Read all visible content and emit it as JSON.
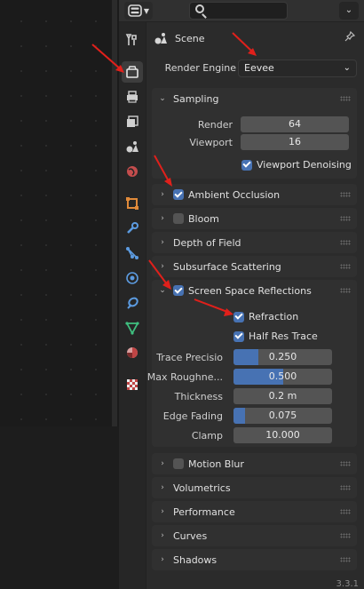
{
  "header": {
    "editor_type_icon": "properties-editor-icon",
    "search_placeholder": "",
    "options_icon": "chevron-down-icon"
  },
  "tabs": [
    {
      "name": "tool",
      "icon": "tool-icon"
    },
    {
      "name": "render",
      "icon": "camera-back-icon",
      "active": true
    },
    {
      "name": "output",
      "icon": "printer-icon"
    },
    {
      "name": "view-layer",
      "icon": "image-stack-icon"
    },
    {
      "name": "scene",
      "icon": "scene-icon"
    },
    {
      "name": "world",
      "icon": "world-icon"
    },
    {
      "name": "object",
      "icon": "object-icon"
    },
    {
      "name": "modifiers",
      "icon": "wrench-icon"
    },
    {
      "name": "particles",
      "icon": "particles-icon"
    },
    {
      "name": "physics",
      "icon": "physics-icon"
    },
    {
      "name": "constraints",
      "icon": "constraint-icon"
    },
    {
      "name": "data",
      "icon": "mesh-data-icon"
    },
    {
      "name": "material",
      "icon": "material-icon"
    },
    {
      "name": "texture",
      "icon": "texture-icon"
    }
  ],
  "scene_label": "Scene",
  "render_engine": {
    "label": "Render Engine",
    "value": "Eevee"
  },
  "sampling": {
    "title": "Sampling",
    "render_label": "Render",
    "render_value": "64",
    "viewport_label": "Viewport",
    "viewport_value": "16",
    "denoise_label": "Viewport Denoising",
    "denoise_checked": true
  },
  "panels": {
    "ao": "Ambient Occlusion",
    "bloom": "Bloom",
    "dof": "Depth of Field",
    "sss": "Subsurface Scattering",
    "ssr": "Screen Space Reflections",
    "motion_blur": "Motion Blur",
    "volumetrics": "Volumetrics",
    "performance": "Performance",
    "curves": "Curves",
    "shadows": "Shadows"
  },
  "ssr": {
    "refraction_label": "Refraction",
    "half_res_label": "Half Res Trace",
    "trace_label": "Trace Precisio",
    "trace_value": "0.250",
    "trace_fill": 0.25,
    "rough_label": "Max Roughne...",
    "rough_value": "0.500",
    "rough_fill": 0.5,
    "thickness_label": "Thickness",
    "thickness_value": "0.2 m",
    "edge_label": "Edge Fading",
    "edge_value": "0.075",
    "edge_fill": 0.12,
    "clamp_label": "Clamp",
    "clamp_value": "10.000"
  },
  "version": "3.3.1",
  "colors": {
    "accent": "#4772b3",
    "annotation_arrow": "#e0201b"
  }
}
